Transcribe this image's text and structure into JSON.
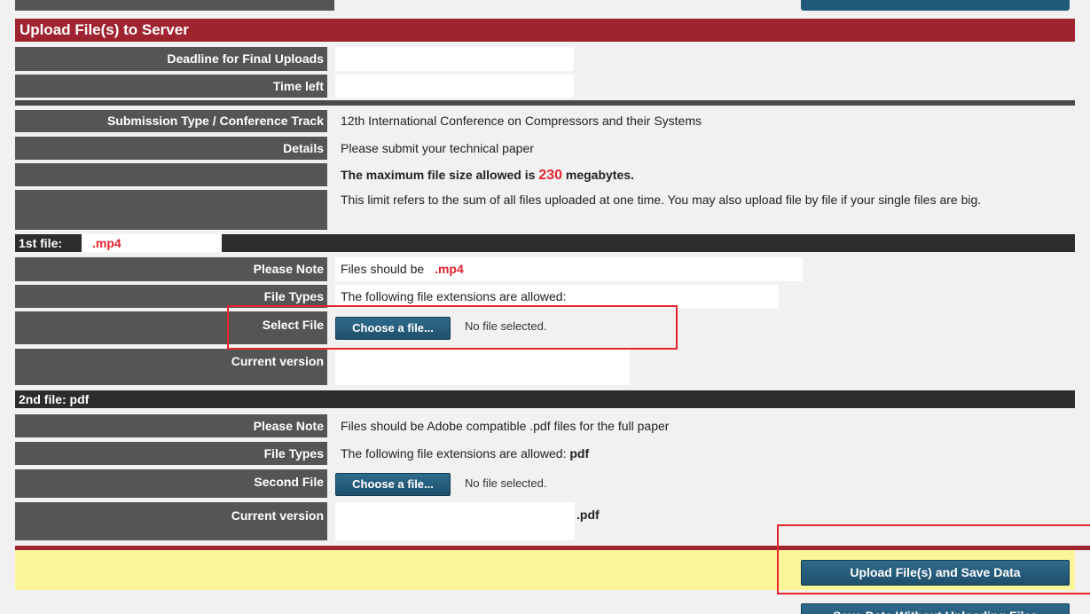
{
  "section_title": "Upload File(s) to Server",
  "deadline": {
    "label": "Deadline for Final Uploads",
    "value": ""
  },
  "time_left": {
    "label": "Time left",
    "value": ""
  },
  "submission": {
    "label": "Submission Type / Conference Track",
    "value": "12th International Conference on Compressors and their Systems"
  },
  "details": {
    "label": "Details",
    "value": "Please submit your technical paper",
    "max_prefix": "The maximum file size allowed is",
    "max_number": "230",
    "max_suffix": "megabytes.",
    "limit_note": "This limit refers to the sum of all files uploaded at one time. You may also upload file by file if your single files are big."
  },
  "file1": {
    "header_prefix": "1st file:",
    "header_ext": ".mp4",
    "note_label": "Please Note",
    "note_prefix": "Files should be",
    "note_ext": ".mp4",
    "types_label": "File Types",
    "types_value": "The following file extensions are allowed:",
    "select_label": "Select File",
    "choose_button": "Choose a file...",
    "no_file": "No file selected.",
    "current_label": "Current version",
    "current_value": ""
  },
  "file2": {
    "header": "2nd file: pdf",
    "note_label": "Please Note",
    "note_value": "Files should be Adobe compatible .pdf files for the full paper",
    "types_label": "File Types",
    "types_value": "The following file extensions are allowed:",
    "types_ext": "pdf",
    "select_label": "Second File",
    "choose_button": "Choose a file...",
    "no_file": "No file selected.",
    "current_label": "Current version",
    "current_ext": ".pdf"
  },
  "actions": {
    "upload_save": "Upload File(s) and Save Data",
    "save_without": "Save Data Without Uploading Files"
  },
  "colors": {
    "header_red": "#a0242f",
    "label_gray": "#555555",
    "dark_header": "#2c2c2c",
    "highlight_red": "#e8242d",
    "yellow_band": "#fbf59a",
    "button_blue": "#2a6386"
  }
}
